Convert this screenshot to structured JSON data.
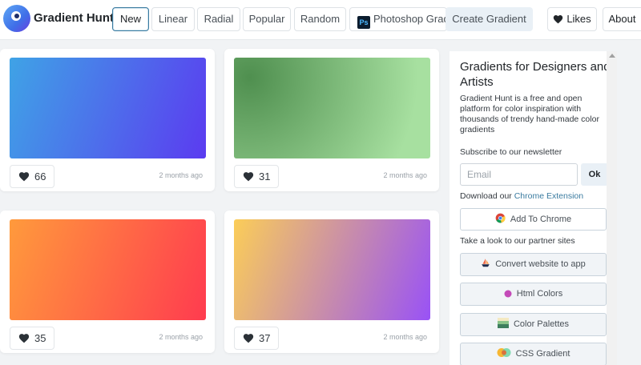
{
  "header": {
    "brand": "Gradient Hunt",
    "nav": [
      {
        "label": "New",
        "active": true
      },
      {
        "label": "Linear"
      },
      {
        "label": "Radial"
      },
      {
        "label": "Popular"
      },
      {
        "label": "Random"
      },
      {
        "label": "Photoshop Gradi",
        "icon": "photoshop-icon"
      }
    ],
    "create_label": "Create Gradient",
    "likes_label": "Likes",
    "about_label": "About"
  },
  "cards": [
    {
      "likes": "66",
      "time": "2 months ago",
      "colors": [
        "#3fa3e6",
        "#5b3bf0"
      ]
    },
    {
      "likes": "31",
      "time": "2 months ago",
      "colors": [
        "#4f8f4f",
        "#a7e0a0"
      ]
    },
    {
      "likes": "35",
      "time": "2 months ago",
      "colors": [
        "#ff9a3c",
        "#ff3b4f"
      ]
    },
    {
      "likes": "37",
      "time": "2 months ago",
      "colors": [
        "#fbcd58",
        "#9952f6"
      ]
    }
  ],
  "sidebar": {
    "title": "Gradients for Designers and Artists",
    "description": "Gradient Hunt is a free and open platform for color inspiration with thousands of trendy hand-made color gradients",
    "newsletter_label": "Subscribe to our newsletter",
    "email_placeholder": "Email",
    "ok_label": "Ok",
    "download_prefix": "Download our ",
    "download_link": "Chrome Extension",
    "add_chrome_label": "Add To Chrome",
    "partners_label": "Take a look to our partner sites",
    "partners": [
      "Convert website to app",
      "Html Colors",
      "Color Palettes",
      "CSS Gradient"
    ]
  }
}
